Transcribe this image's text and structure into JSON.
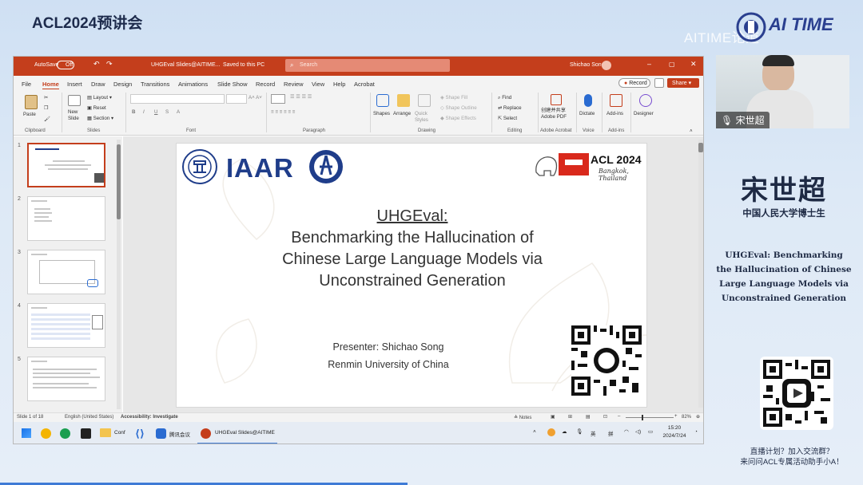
{
  "event": {
    "title": "ACL2024预讲会",
    "logo_text": "AI TIME",
    "watermark": "AITIME论道"
  },
  "ppt": {
    "titlebar": {
      "autosave_label": "AutoSave",
      "autosave_state": "Off",
      "filename": "UHGEval Slides@AITIME...",
      "saved": "Saved to this PC",
      "search_placeholder": "Search",
      "user": "Shichao Song"
    },
    "menu": [
      "File",
      "Home",
      "Insert",
      "Draw",
      "Design",
      "Transitions",
      "Animations",
      "Slide Show",
      "Record",
      "Review",
      "View",
      "Help",
      "Acrobat"
    ],
    "record_button": "Record",
    "share_button": "Share",
    "ribbon": {
      "clipboard": {
        "label": "Clipboard",
        "paste": "Paste"
      },
      "slides": {
        "label": "Slides",
        "new_slide": "New Slide",
        "layout": "Layout",
        "reset": "Reset",
        "section": "Section"
      },
      "font": {
        "label": "Font"
      },
      "paragraph": {
        "label": "Paragraph"
      },
      "drawing": {
        "label": "Drawing",
        "shapes": "Shapes",
        "arrange": "Arrange",
        "quick_styles": "Quick Styles",
        "shape_fill": "Shape Fill",
        "shape_outline": "Shape Outline",
        "shape_effects": "Shape Effects"
      },
      "editing": {
        "label": "Editing",
        "find": "Find",
        "replace": "Replace",
        "select": "Select"
      },
      "acrobat": {
        "label": "Adobe Acrobat",
        "create": "创建并共享 Adobe PDF"
      },
      "voice": {
        "label": "Voice",
        "dictate": "Dictate"
      },
      "addins": {
        "label": "Add-ins",
        "addins": "Add-ins"
      },
      "designer": {
        "designer": "Designer"
      }
    },
    "thumbnails": [
      "1",
      "2",
      "3",
      "4",
      "5"
    ],
    "slide": {
      "logo_iaar": "IAAR",
      "acl": "ACL 2024",
      "acl_sub": "Bangkok, Thailand",
      "title": "UHGEval:",
      "subtitle_lines": [
        "Benchmarking the Hallucination of",
        "Chinese Large Language Models via",
        "Unconstrained Generation"
      ],
      "presenter": "Presenter: Shichao Song",
      "affiliation": "Renmin University of China"
    },
    "status": {
      "slide_count": "Slide 1 of 18",
      "language": "English (United States)",
      "accessibility": "Accessibility: Investigate",
      "notes": "Notes",
      "zoom": "82%"
    },
    "taskbar": {
      "conf": "Conf",
      "meeting": "腾讯会议",
      "ppt_task": "UHGEval Slides@AITIME",
      "ime_lang": "英",
      "ime_mode": "拼",
      "time": "15:20",
      "date": "2024/7/24"
    }
  },
  "camera": {
    "name": "宋世超"
  },
  "speaker": {
    "name": "宋世超",
    "affiliation": "中国人民大学博士生",
    "talk_title": "UHGEval: Benchmarking the Hallucination of Chinese Large Language Models via Unconstrained Generation"
  },
  "cta": {
    "line1": "直播计划？加入交流群？",
    "line2": "来问问ACL专属活动助手小A！"
  }
}
